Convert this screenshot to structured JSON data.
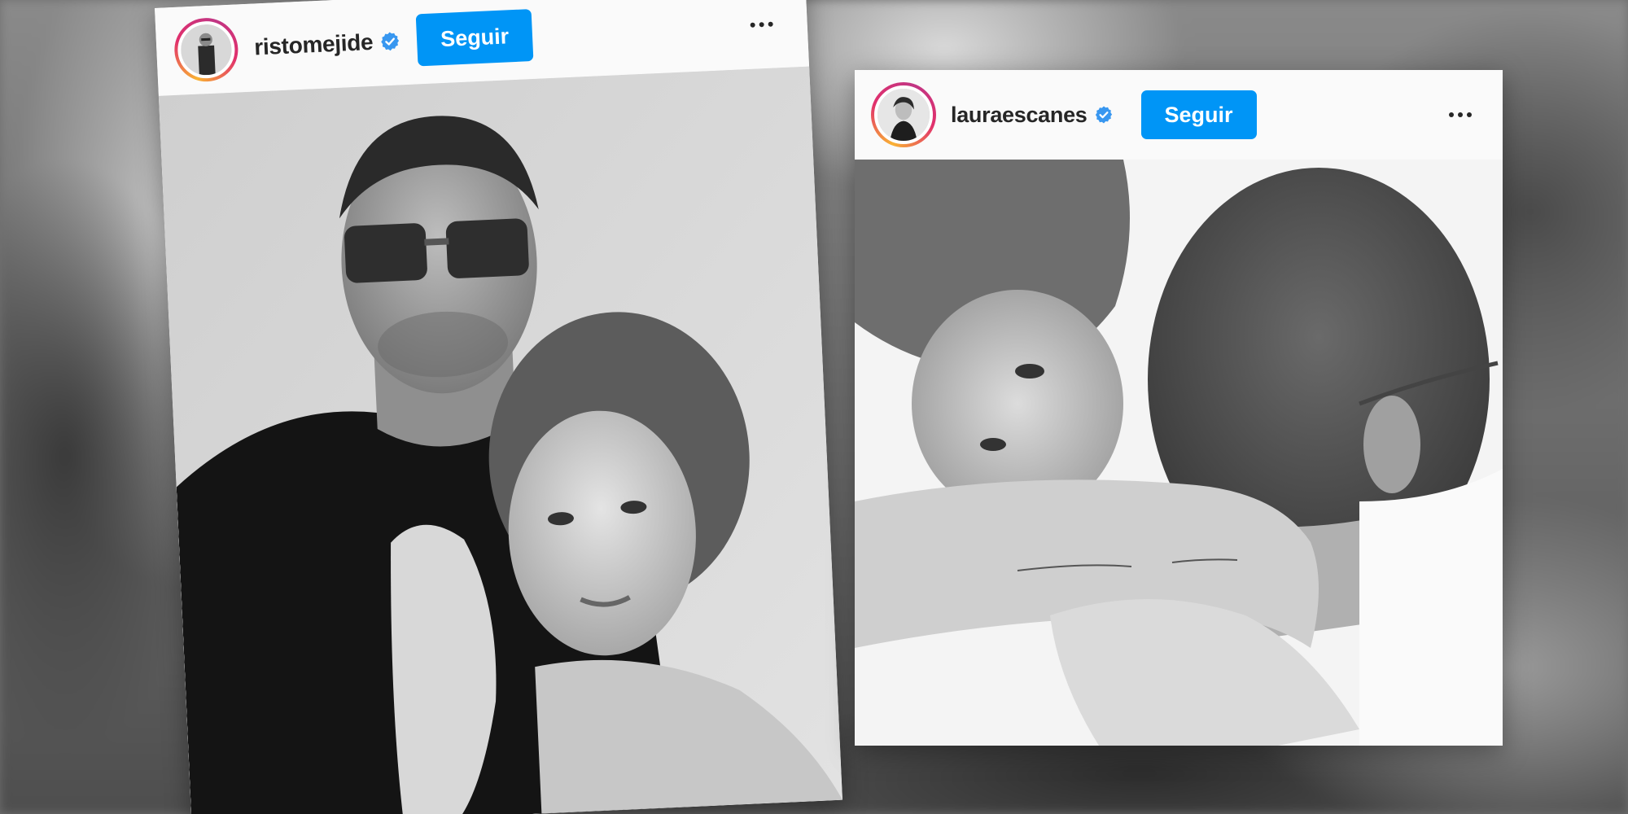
{
  "posts": [
    {
      "username": "ristomejide",
      "verified": true,
      "follow_label": "Seguir"
    },
    {
      "username": "lauraescanes",
      "verified": true,
      "follow_label": "Seguir"
    }
  ],
  "colors": {
    "follow_button": "#0095f6",
    "verified_badge": "#3897f0",
    "username_text": "#262626",
    "header_bg": "#fafafa"
  },
  "icons": {
    "verified": "verified-badge-icon",
    "more": "more-options-icon"
  }
}
